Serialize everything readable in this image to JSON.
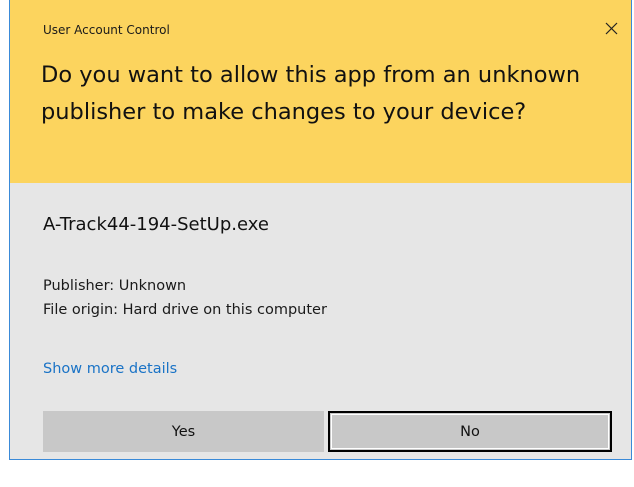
{
  "dialog": {
    "window_title": "User Account Control",
    "close_glyph": "✕",
    "question": "Do you want to allow this app from an unknown publisher to make changes to your device?",
    "app_name": "A-Track44-194-SetUp.exe",
    "publisher": "Publisher: Unknown",
    "file_origin": "File origin: Hard drive on this computer",
    "details_link": "Show more details",
    "yes_label": "Yes",
    "no_label": "No"
  },
  "colors": {
    "header_background": "#fcd45e",
    "body_background": "#e6e6e6",
    "link": "#1a73c6",
    "button": "#c8c8c8",
    "window_border": "#3a8ad8"
  }
}
